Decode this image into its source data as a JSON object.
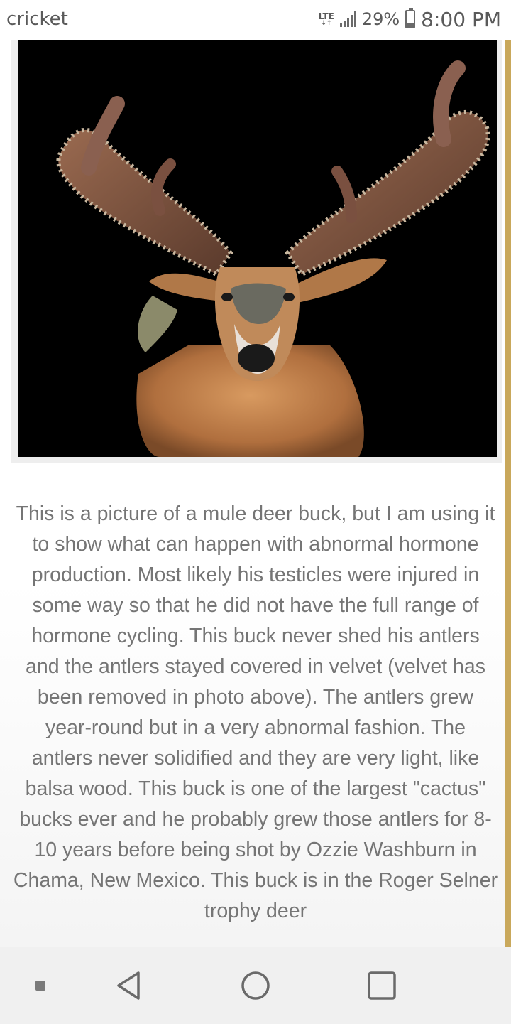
{
  "status_bar": {
    "carrier": "cricket",
    "network": "LTE",
    "battery_percent": "29%",
    "battery_level": 0.29,
    "time": "8:00 PM",
    "icons": [
      "signal-icon",
      "battery-icon"
    ]
  },
  "article": {
    "image_alt": "mule deer buck with cactus antlers",
    "paragraph": "This is a picture of a mule deer buck, but I am using it to show what can happen with abnormal hormone production. Most likely his testicles were injured in some way so that he did not have the full range of hormone cycling. This buck never shed his antlers and the antlers stayed covered in velvet (velvet has been removed in photo above). The antlers grew year-round but in a very abnormal fashion. The antlers never solidified and they are very light, like balsa wood. This buck is one of the largest \"cactus\" bucks ever and he probably grew those antlers for 8-10 years before being shot by Ozzie Washburn in Chama, New Mexico. This buck is in the Roger Selner trophy deer"
  },
  "nav_bar": {
    "buttons": [
      "menu-dot-icon",
      "back-icon",
      "home-icon",
      "recents-icon"
    ]
  },
  "colors": {
    "accent_rule": "#c9a85b",
    "text": "#757575",
    "nav_bg": "#f0f0f0"
  }
}
